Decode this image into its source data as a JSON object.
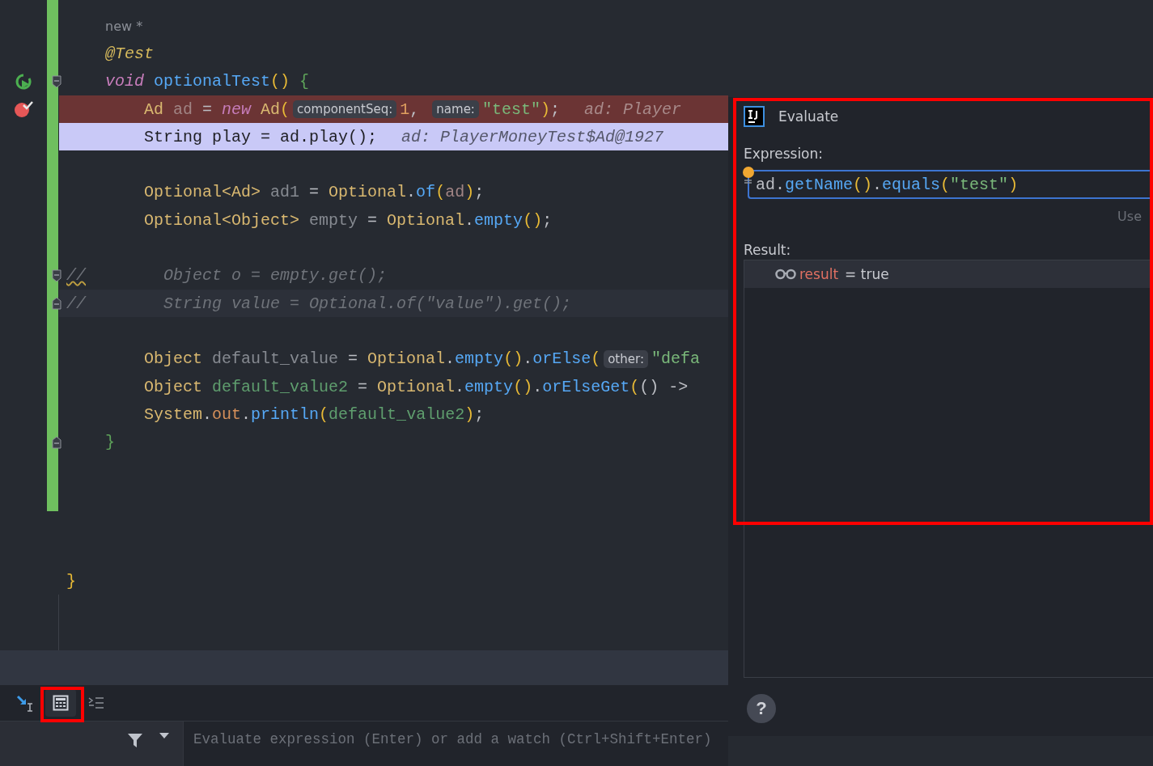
{
  "editor": {
    "lines": [
      {
        "kind": "normal",
        "tokens": [
          {
            "text": "new *",
            "kind": "author"
          }
        ]
      },
      {
        "kind": "normal",
        "tokens": [
          {
            "text": "    @Test",
            "kind": "annotation"
          }
        ]
      },
      {
        "kind": "normal",
        "gutter": [
          {
            "kind": "run"
          },
          {
            "kind": "fold-start"
          }
        ],
        "tokens": [
          {
            "text": "    void",
            "kind": "keyword"
          },
          {
            "text": " optionalTest",
            "kind": "method"
          },
          {
            "text": "()",
            "kind": "paren"
          },
          {
            "text": " {",
            "kind": "brace"
          }
        ]
      },
      {
        "kind": "breakpoint",
        "gutter": [
          {
            "kind": "breakpoint"
          }
        ],
        "tokens": [
          {
            "text": "        Ad",
            "kind": "type"
          },
          {
            "text": " ad",
            "kind": "local-dim"
          },
          {
            "text": " = ",
            "kind": "plain"
          },
          {
            "text": "new",
            "kind": "keyword"
          },
          {
            "text": " Ad",
            "kind": "type"
          },
          {
            "text": "(",
            "kind": "paren"
          },
          {
            "text": "componentSeq:",
            "kind": "inlay"
          },
          {
            "text": "1",
            "kind": "number"
          },
          {
            "text": ", ",
            "kind": "plain"
          },
          {
            "text": "name:",
            "kind": "inlay"
          },
          {
            "text": "\"test\"",
            "kind": "string"
          },
          {
            "text": ")",
            "kind": "paren"
          },
          {
            "text": ";",
            "kind": "plain"
          },
          {
            "text": "ad: Player",
            "kind": "hint"
          }
        ]
      },
      {
        "kind": "execution",
        "tokens": [
          {
            "text": "        String play = ad.play();",
            "kind": "plain"
          },
          {
            "text": "ad: PlayerMoneyTest$Ad@1927",
            "kind": "hint"
          }
        ]
      },
      {
        "kind": "normal"
      },
      {
        "kind": "normal",
        "tokens": [
          {
            "text": "        Optional<Ad>",
            "kind": "type"
          },
          {
            "text": " ad1",
            "kind": "unused"
          },
          {
            "text": " = ",
            "kind": "plain"
          },
          {
            "text": "Optional",
            "kind": "type"
          },
          {
            "text": ".",
            "kind": "plain"
          },
          {
            "text": "of",
            "kind": "method"
          },
          {
            "text": "(",
            "kind": "paren"
          },
          {
            "text": "ad",
            "kind": "local-dim"
          },
          {
            "text": ")",
            "kind": "paren"
          },
          {
            "text": ";",
            "kind": "plain"
          }
        ]
      },
      {
        "kind": "normal",
        "tokens": [
          {
            "text": "        Optional<Object>",
            "kind": "type"
          },
          {
            "text": " empty",
            "kind": "unused"
          },
          {
            "text": " = ",
            "kind": "plain"
          },
          {
            "text": "Optional",
            "kind": "type"
          },
          {
            "text": ".",
            "kind": "plain"
          },
          {
            "text": "empty",
            "kind": "method"
          },
          {
            "text": "()",
            "kind": "paren"
          },
          {
            "text": ";",
            "kind": "plain"
          }
        ]
      },
      {
        "kind": "normal"
      },
      {
        "kind": "normal",
        "gutter": [
          {
            "kind": "fold-start"
          }
        ],
        "tokens": [
          {
            "text": "//",
            "kind": "comment-warn"
          },
          {
            "text": "        Object o = empty.get();",
            "kind": "comment"
          }
        ]
      },
      {
        "kind": "caret",
        "gutter": [
          {
            "kind": "fold-end"
          }
        ],
        "tokens": [
          {
            "text": "//",
            "kind": "comment"
          },
          {
            "text": "        String value = Optional.of(\"value\").get();",
            "kind": "comment"
          }
        ]
      },
      {
        "kind": "normal"
      },
      {
        "kind": "normal",
        "tokens": [
          {
            "text": "        Object",
            "kind": "type"
          },
          {
            "text": " default_value",
            "kind": "unused"
          },
          {
            "text": " = ",
            "kind": "plain"
          },
          {
            "text": "Optional",
            "kind": "type"
          },
          {
            "text": ".",
            "kind": "plain"
          },
          {
            "text": "empty",
            "kind": "method"
          },
          {
            "text": "()",
            "kind": "paren"
          },
          {
            "text": ".",
            "kind": "plain"
          },
          {
            "text": "orElse",
            "kind": "method"
          },
          {
            "text": "(",
            "kind": "paren"
          },
          {
            "text": "other:",
            "kind": "inlay"
          },
          {
            "text": "\"defa",
            "kind": "string"
          }
        ]
      },
      {
        "kind": "normal",
        "tokens": [
          {
            "text": "        Object",
            "kind": "type"
          },
          {
            "text": " default_value2",
            "kind": "local-green"
          },
          {
            "text": " = ",
            "kind": "plain"
          },
          {
            "text": "Optional",
            "kind": "type"
          },
          {
            "text": ".",
            "kind": "plain"
          },
          {
            "text": "empty",
            "kind": "method"
          },
          {
            "text": "()",
            "kind": "paren"
          },
          {
            "text": ".",
            "kind": "plain"
          },
          {
            "text": "orElseGet",
            "kind": "method"
          },
          {
            "text": "(",
            "kind": "paren"
          },
          {
            "text": "() ->",
            "kind": "plain"
          }
        ]
      },
      {
        "kind": "normal",
        "tokens": [
          {
            "text": "        System",
            "kind": "type"
          },
          {
            "text": ".",
            "kind": "plain"
          },
          {
            "text": "out",
            "kind": "field"
          },
          {
            "text": ".",
            "kind": "plain"
          },
          {
            "text": "println",
            "kind": "method"
          },
          {
            "text": "(",
            "kind": "paren"
          },
          {
            "text": "default_value2",
            "kind": "local-green"
          },
          {
            "text": ")",
            "kind": "paren"
          },
          {
            "text": ";",
            "kind": "plain"
          }
        ]
      },
      {
        "kind": "normal",
        "gutter": [
          {
            "kind": "fold-end"
          }
        ],
        "tokens": [
          {
            "text": "    }",
            "kind": "brace"
          }
        ]
      },
      {
        "kind": "normal"
      },
      {
        "kind": "normal"
      },
      {
        "kind": "normal"
      },
      {
        "kind": "normal"
      },
      {
        "kind": "normal",
        "tokens": [
          {
            "text": "}",
            "kind": "paren"
          }
        ]
      }
    ]
  },
  "debug_toolbar": {
    "buttons": [
      {
        "kind": "step",
        "selected": false
      },
      {
        "kind": "calculator",
        "selected": true
      },
      {
        "kind": "list",
        "selected": false
      }
    ]
  },
  "watches": {
    "placeholder": "Evaluate expression (Enter) or add a watch (Ctrl+Shift+Enter)"
  },
  "evaluate_dialog": {
    "title": "Evaluate",
    "expression_label": "Expression:",
    "expression": [
      {
        "text": "ad",
        "kind": "plain"
      },
      {
        "text": ".",
        "kind": "plain"
      },
      {
        "text": "getName",
        "kind": "method"
      },
      {
        "text": "()",
        "kind": "paren"
      },
      {
        "text": ".",
        "kind": "plain"
      },
      {
        "text": "equals",
        "kind": "method"
      },
      {
        "text": "(",
        "kind": "paren"
      },
      {
        "text": "\"test\"",
        "kind": "string"
      },
      {
        "text": ")",
        "kind": "paren"
      }
    ],
    "hint": "Use",
    "result_label": "Result:",
    "result": {
      "name": "result",
      "value": "= true"
    },
    "help": "?"
  }
}
